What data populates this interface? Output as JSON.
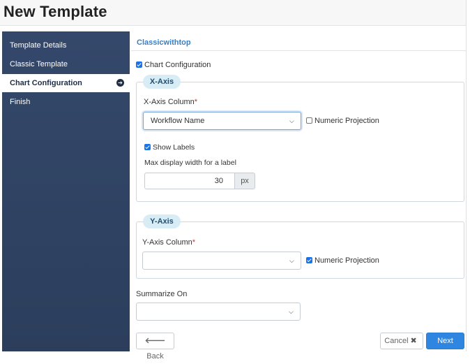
{
  "header": {
    "title": "New Template"
  },
  "sidebar": {
    "items": [
      {
        "label": "Template Details"
      },
      {
        "label": "Classic Template"
      },
      {
        "label": "Chart Configuration"
      },
      {
        "label": "Finish"
      }
    ]
  },
  "main": {
    "template_name": "Classicwithtop",
    "chart_config_label": "Chart Configuration",
    "x_axis": {
      "legend": "X-Axis",
      "column_label": "X-Axis Column",
      "required_mark": "*",
      "column_value": "Workflow Name",
      "numeric_projection_label": "Numeric Projection",
      "show_labels_label": "Show Labels",
      "max_width_label": "Max display width for a label",
      "max_width_value": "30",
      "unit": "px"
    },
    "y_axis": {
      "legend": "Y-Axis",
      "column_label": "Y-Axis Column",
      "required_mark": "*",
      "column_value": "",
      "numeric_projection_label": "Numeric Projection"
    },
    "summarize": {
      "label": "Summarize On",
      "value": ""
    }
  },
  "footer": {
    "back_label": "Back",
    "cancel_label": "Cancel",
    "next_label": "Next"
  },
  "colors": {
    "sidebar": "#2f4262",
    "accent": "#2f86e0",
    "legend_bg": "#d7ecf5"
  }
}
